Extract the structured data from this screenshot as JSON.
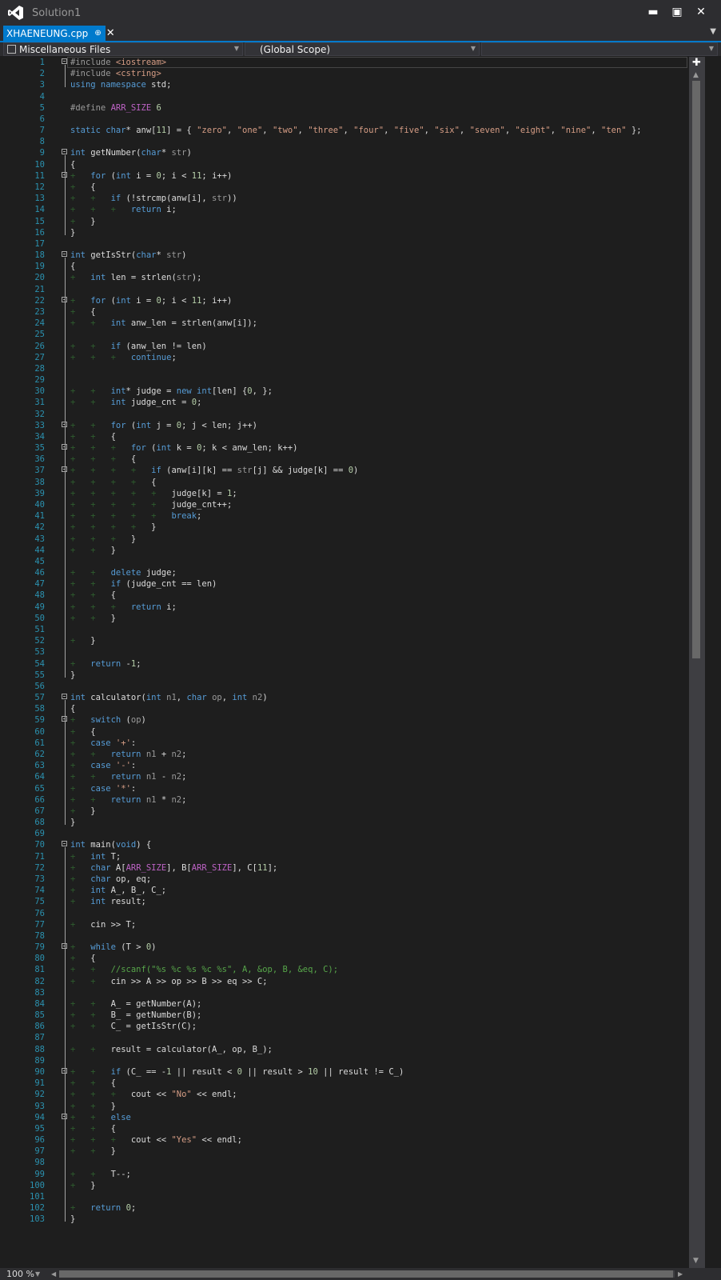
{
  "window": {
    "title": "Solution1"
  },
  "tab": {
    "label": "XHAENEUNG.cpp",
    "pin_glyph": "⊕",
    "close_glyph": "✕"
  },
  "navbar": {
    "project": "Miscellaneous Files",
    "scope": "(Global Scope)",
    "member": ""
  },
  "status": {
    "zoom": "100 %"
  },
  "code": {
    "fold_lines": [
      1,
      9,
      11,
      18,
      22,
      33,
      35,
      37,
      57,
      59,
      70,
      79,
      90,
      94
    ],
    "lines": [
      [
        [
          "pp",
          "#include "
        ],
        [
          "inc",
          "<iostream>"
        ]
      ],
      [
        [
          "pp",
          "#include "
        ],
        [
          "inc",
          "<cstring>"
        ]
      ],
      [
        [
          "kw",
          "using namespace "
        ],
        [
          "t",
          "std;"
        ]
      ],
      [],
      [
        [
          "pp",
          "#define "
        ],
        [
          "mac",
          "ARR_SIZE"
        ],
        [
          "t",
          " "
        ],
        [
          "num",
          "6"
        ]
      ],
      [],
      [
        [
          "kw",
          "static char"
        ],
        [
          "t",
          "* anw["
        ],
        [
          "num",
          "11"
        ],
        [
          "t",
          "] = { "
        ],
        [
          "str",
          "\"zero\""
        ],
        [
          "t",
          ", "
        ],
        [
          "str",
          "\"one\""
        ],
        [
          "t",
          ", "
        ],
        [
          "str",
          "\"two\""
        ],
        [
          "t",
          ", "
        ],
        [
          "str",
          "\"three\""
        ],
        [
          "t",
          ", "
        ],
        [
          "str",
          "\"four\""
        ],
        [
          "t",
          ", "
        ],
        [
          "str",
          "\"five\""
        ],
        [
          "t",
          ", "
        ],
        [
          "str",
          "\"six\""
        ],
        [
          "t",
          ", "
        ],
        [
          "str",
          "\"seven\""
        ],
        [
          "t",
          ", "
        ],
        [
          "str",
          "\"eight\""
        ],
        [
          "t",
          ", "
        ],
        [
          "str",
          "\"nine\""
        ],
        [
          "t",
          ", "
        ],
        [
          "str",
          "\"ten\""
        ],
        [
          "t",
          " };"
        ]
      ],
      [],
      [
        [
          "kw",
          "int"
        ],
        [
          "t",
          " getNumber("
        ],
        [
          "kw",
          "char"
        ],
        [
          "t",
          "* "
        ],
        [
          "prm",
          "str"
        ],
        [
          "t",
          ")"
        ]
      ],
      [
        [
          "t",
          "{"
        ]
      ],
      [
        [
          "g",
          "+   "
        ],
        [
          "kw",
          "for"
        ],
        [
          "t",
          " ("
        ],
        [
          "kw",
          "int"
        ],
        [
          "t",
          " i = "
        ],
        [
          "num",
          "0"
        ],
        [
          "t",
          "; i < "
        ],
        [
          "num",
          "11"
        ],
        [
          "t",
          "; i++)"
        ]
      ],
      [
        [
          "g",
          "+   "
        ],
        [
          "t",
          "{"
        ]
      ],
      [
        [
          "g",
          "+   +   "
        ],
        [
          "kw",
          "if"
        ],
        [
          "t",
          " (!strcmp(anw[i], "
        ],
        [
          "prm",
          "str"
        ],
        [
          "t",
          "))"
        ]
      ],
      [
        [
          "g",
          "+   +   +   "
        ],
        [
          "kw",
          "return"
        ],
        [
          "t",
          " i;"
        ]
      ],
      [
        [
          "g",
          "+   "
        ],
        [
          "t",
          "}"
        ]
      ],
      [
        [
          "t",
          "}"
        ]
      ],
      [],
      [
        [
          "kw",
          "int"
        ],
        [
          "t",
          " getIsStr("
        ],
        [
          "kw",
          "char"
        ],
        [
          "t",
          "* "
        ],
        [
          "prm",
          "str"
        ],
        [
          "t",
          ")"
        ]
      ],
      [
        [
          "t",
          "{"
        ]
      ],
      [
        [
          "g",
          "+   "
        ],
        [
          "kw",
          "int"
        ],
        [
          "t",
          " len = strlen("
        ],
        [
          "prm",
          "str"
        ],
        [
          "t",
          ");"
        ]
      ],
      [],
      [
        [
          "g",
          "+   "
        ],
        [
          "kw",
          "for"
        ],
        [
          "t",
          " ("
        ],
        [
          "kw",
          "int"
        ],
        [
          "t",
          " i = "
        ],
        [
          "num",
          "0"
        ],
        [
          "t",
          "; i < "
        ],
        [
          "num",
          "11"
        ],
        [
          "t",
          "; i++)"
        ]
      ],
      [
        [
          "g",
          "+   "
        ],
        [
          "t",
          "{"
        ]
      ],
      [
        [
          "g",
          "+   +   "
        ],
        [
          "kw",
          "int"
        ],
        [
          "t",
          " anw_len = strlen(anw[i]);"
        ]
      ],
      [],
      [
        [
          "g",
          "+   +   "
        ],
        [
          "kw",
          "if"
        ],
        [
          "t",
          " (anw_len != len)"
        ]
      ],
      [
        [
          "g",
          "+   +   +   "
        ],
        [
          "kw",
          "continue"
        ],
        [
          "t",
          ";"
        ]
      ],
      [],
      [],
      [
        [
          "g",
          "+   +   "
        ],
        [
          "kw",
          "int"
        ],
        [
          "t",
          "* judge = "
        ],
        [
          "kw",
          "new int"
        ],
        [
          "t",
          "[len] {"
        ],
        [
          "num",
          "0"
        ],
        [
          "t",
          ", };"
        ]
      ],
      [
        [
          "g",
          "+   +   "
        ],
        [
          "kw",
          "int"
        ],
        [
          "t",
          " judge_cnt = "
        ],
        [
          "num",
          "0"
        ],
        [
          "t",
          ";"
        ]
      ],
      [],
      [
        [
          "g",
          "+   +   "
        ],
        [
          "kw",
          "for"
        ],
        [
          "t",
          " ("
        ],
        [
          "kw",
          "int"
        ],
        [
          "t",
          " j = "
        ],
        [
          "num",
          "0"
        ],
        [
          "t",
          "; j < len; j++)"
        ]
      ],
      [
        [
          "g",
          "+   +   "
        ],
        [
          "t",
          "{"
        ]
      ],
      [
        [
          "g",
          "+   +   +   "
        ],
        [
          "kw",
          "for"
        ],
        [
          "t",
          " ("
        ],
        [
          "kw",
          "int"
        ],
        [
          "t",
          " k = "
        ],
        [
          "num",
          "0"
        ],
        [
          "t",
          "; k < anw_len; k++)"
        ]
      ],
      [
        [
          "g",
          "+   +   +   "
        ],
        [
          "t",
          "{"
        ]
      ],
      [
        [
          "g",
          "+   +   +   +   "
        ],
        [
          "kw",
          "if"
        ],
        [
          "t",
          " (anw[i][k] == "
        ],
        [
          "prm",
          "str"
        ],
        [
          "t",
          "[j] && judge[k] == "
        ],
        [
          "num",
          "0"
        ],
        [
          "t",
          ")"
        ]
      ],
      [
        [
          "g",
          "+   +   +   +   "
        ],
        [
          "t",
          "{"
        ]
      ],
      [
        [
          "g",
          "+   +   +   +   +   "
        ],
        [
          "t",
          "judge[k] = "
        ],
        [
          "num",
          "1"
        ],
        [
          "t",
          ";"
        ]
      ],
      [
        [
          "g",
          "+   +   +   +   +   "
        ],
        [
          "t",
          "judge_cnt++;"
        ]
      ],
      [
        [
          "g",
          "+   +   +   +   +   "
        ],
        [
          "kw",
          "break"
        ],
        [
          "t",
          ";"
        ]
      ],
      [
        [
          "g",
          "+   +   +   +   "
        ],
        [
          "t",
          "}"
        ]
      ],
      [
        [
          "g",
          "+   +   +   "
        ],
        [
          "t",
          "}"
        ]
      ],
      [
        [
          "g",
          "+   +   "
        ],
        [
          "t",
          "}"
        ]
      ],
      [],
      [
        [
          "g",
          "+   +   "
        ],
        [
          "kw",
          "delete"
        ],
        [
          "t",
          " judge;"
        ]
      ],
      [
        [
          "g",
          "+   +   "
        ],
        [
          "kw",
          "if"
        ],
        [
          "t",
          " (judge_cnt == len)"
        ]
      ],
      [
        [
          "g",
          "+   +   "
        ],
        [
          "t",
          "{"
        ]
      ],
      [
        [
          "g",
          "+   +   +   "
        ],
        [
          "kw",
          "return"
        ],
        [
          "t",
          " i;"
        ]
      ],
      [
        [
          "g",
          "+   +   "
        ],
        [
          "t",
          "}"
        ]
      ],
      [],
      [
        [
          "g",
          "+   "
        ],
        [
          "t",
          "}"
        ]
      ],
      [],
      [
        [
          "g",
          "+   "
        ],
        [
          "kw",
          "return"
        ],
        [
          "t",
          " -"
        ],
        [
          "num",
          "1"
        ],
        [
          "t",
          ";"
        ]
      ],
      [
        [
          "t",
          "}"
        ]
      ],
      [],
      [
        [
          "kw",
          "int"
        ],
        [
          "t",
          " calculator("
        ],
        [
          "kw",
          "int"
        ],
        [
          "t",
          " "
        ],
        [
          "prm",
          "n1"
        ],
        [
          "t",
          ", "
        ],
        [
          "kw",
          "char"
        ],
        [
          "t",
          " "
        ],
        [
          "prm",
          "op"
        ],
        [
          "t",
          ", "
        ],
        [
          "kw",
          "int"
        ],
        [
          "t",
          " "
        ],
        [
          "prm",
          "n2"
        ],
        [
          "t",
          ")"
        ]
      ],
      [
        [
          "t",
          "{"
        ]
      ],
      [
        [
          "g",
          "+   "
        ],
        [
          "kw",
          "switch"
        ],
        [
          "t",
          " ("
        ],
        [
          "prm",
          "op"
        ],
        [
          "t",
          ")"
        ]
      ],
      [
        [
          "g",
          "+   "
        ],
        [
          "t",
          "{"
        ]
      ],
      [
        [
          "g",
          "+   "
        ],
        [
          "kw",
          "case"
        ],
        [
          "t",
          " "
        ],
        [
          "str",
          "'+'"
        ],
        [
          "t",
          ":"
        ]
      ],
      [
        [
          "g",
          "+   +   "
        ],
        [
          "kw",
          "return"
        ],
        [
          "t",
          " "
        ],
        [
          "prm",
          "n1"
        ],
        [
          "t",
          " + "
        ],
        [
          "prm",
          "n2"
        ],
        [
          "t",
          ";"
        ]
      ],
      [
        [
          "g",
          "+   "
        ],
        [
          "kw",
          "case"
        ],
        [
          "t",
          " "
        ],
        [
          "str",
          "'-'"
        ],
        [
          "t",
          ":"
        ]
      ],
      [
        [
          "g",
          "+   +   "
        ],
        [
          "kw",
          "return"
        ],
        [
          "t",
          " "
        ],
        [
          "prm",
          "n1"
        ],
        [
          "t",
          " - "
        ],
        [
          "prm",
          "n2"
        ],
        [
          "t",
          ";"
        ]
      ],
      [
        [
          "g",
          "+   "
        ],
        [
          "kw",
          "case"
        ],
        [
          "t",
          " "
        ],
        [
          "str",
          "'*'"
        ],
        [
          "t",
          ":"
        ]
      ],
      [
        [
          "g",
          "+   +   "
        ],
        [
          "kw",
          "return"
        ],
        [
          "t",
          " "
        ],
        [
          "prm",
          "n1"
        ],
        [
          "t",
          " * "
        ],
        [
          "prm",
          "n2"
        ],
        [
          "t",
          ";"
        ]
      ],
      [
        [
          "g",
          "+   "
        ],
        [
          "t",
          "}"
        ]
      ],
      [
        [
          "t",
          "}"
        ]
      ],
      [],
      [
        [
          "kw",
          "int"
        ],
        [
          "t",
          " main("
        ],
        [
          "kw",
          "void"
        ],
        [
          "t",
          ") {"
        ]
      ],
      [
        [
          "g",
          "+   "
        ],
        [
          "kw",
          "int"
        ],
        [
          "t",
          " T;"
        ]
      ],
      [
        [
          "g",
          "+   "
        ],
        [
          "kw",
          "char"
        ],
        [
          "t",
          " A["
        ],
        [
          "mac",
          "ARR_SIZE"
        ],
        [
          "t",
          "], B["
        ],
        [
          "mac",
          "ARR_SIZE"
        ],
        [
          "t",
          "], C["
        ],
        [
          "num",
          "11"
        ],
        [
          "t",
          "];"
        ]
      ],
      [
        [
          "g",
          "+   "
        ],
        [
          "kw",
          "char"
        ],
        [
          "t",
          " op, eq;"
        ]
      ],
      [
        [
          "g",
          "+   "
        ],
        [
          "kw",
          "int"
        ],
        [
          "t",
          " A_, B_, C_;"
        ]
      ],
      [
        [
          "g",
          "+   "
        ],
        [
          "kw",
          "int"
        ],
        [
          "t",
          " result;"
        ]
      ],
      [],
      [
        [
          "g",
          "+   "
        ],
        [
          "t",
          "cin >> T;"
        ]
      ],
      [],
      [
        [
          "g",
          "+   "
        ],
        [
          "kw",
          "while"
        ],
        [
          "t",
          " (T > "
        ],
        [
          "num",
          "0"
        ],
        [
          "t",
          ")"
        ]
      ],
      [
        [
          "g",
          "+   "
        ],
        [
          "t",
          "{"
        ]
      ],
      [
        [
          "g",
          "+   +   "
        ],
        [
          "cm",
          "//scanf(\"%s %c %s %c %s\", A, &op, B, &eq, C);"
        ]
      ],
      [
        [
          "g",
          "+   +   "
        ],
        [
          "t",
          "cin >> A >> op >> B >> eq >> C;"
        ]
      ],
      [],
      [
        [
          "g",
          "+   +   "
        ],
        [
          "t",
          "A_ = getNumber(A);"
        ]
      ],
      [
        [
          "g",
          "+   +   "
        ],
        [
          "t",
          "B_ = getNumber(B);"
        ]
      ],
      [
        [
          "g",
          "+   +   "
        ],
        [
          "t",
          "C_ = getIsStr(C);"
        ]
      ],
      [],
      [
        [
          "g",
          "+   +   "
        ],
        [
          "t",
          "result = calculator(A_, op, B_);"
        ]
      ],
      [],
      [
        [
          "g",
          "+   +   "
        ],
        [
          "kw",
          "if"
        ],
        [
          "t",
          " (C_ == -"
        ],
        [
          "num",
          "1"
        ],
        [
          "t",
          " || result < "
        ],
        [
          "num",
          "0"
        ],
        [
          "t",
          " || result > "
        ],
        [
          "num",
          "10"
        ],
        [
          "t",
          " || result != C_)"
        ]
      ],
      [
        [
          "g",
          "+   +   "
        ],
        [
          "t",
          "{"
        ]
      ],
      [
        [
          "g",
          "+   +   +   "
        ],
        [
          "t",
          "cout << "
        ],
        [
          "str",
          "\"No\""
        ],
        [
          "t",
          " << endl;"
        ]
      ],
      [
        [
          "g",
          "+   +   "
        ],
        [
          "t",
          "}"
        ]
      ],
      [
        [
          "g",
          "+   +   "
        ],
        [
          "kw",
          "else"
        ]
      ],
      [
        [
          "g",
          "+   +   "
        ],
        [
          "t",
          "{"
        ]
      ],
      [
        [
          "g",
          "+   +   +   "
        ],
        [
          "t",
          "cout << "
        ],
        [
          "str",
          "\"Yes\""
        ],
        [
          "t",
          " << endl;"
        ]
      ],
      [
        [
          "g",
          "+   +   "
        ],
        [
          "t",
          "}"
        ]
      ],
      [],
      [
        [
          "g",
          "+   +   "
        ],
        [
          "t",
          "T--;"
        ]
      ],
      [
        [
          "g",
          "+   "
        ],
        [
          "t",
          "}"
        ]
      ],
      [],
      [
        [
          "g",
          "+   "
        ],
        [
          "kw",
          "return"
        ],
        [
          "t",
          " "
        ],
        [
          "num",
          "0"
        ],
        [
          "t",
          ";"
        ]
      ],
      [
        [
          "t",
          "}"
        ]
      ]
    ]
  }
}
